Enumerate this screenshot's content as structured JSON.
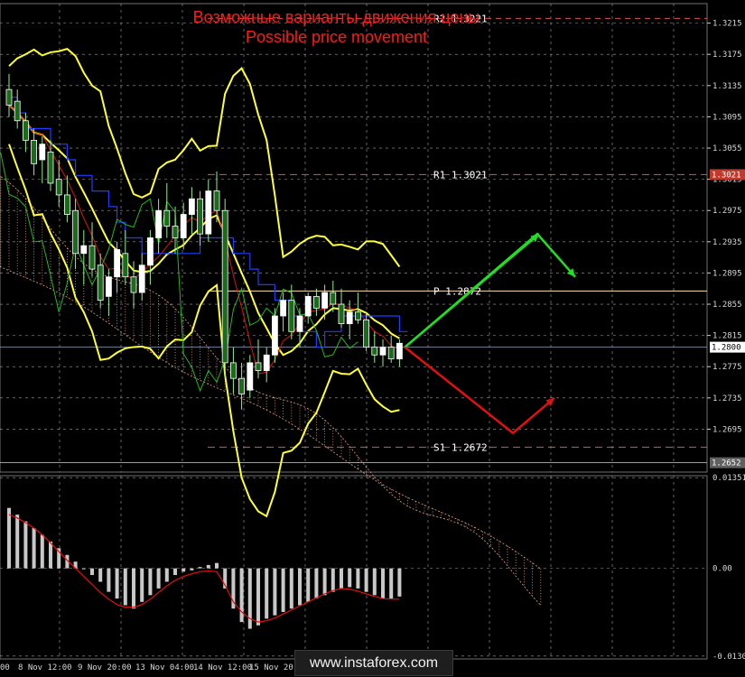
{
  "title_ru": "Возможные варианты движения цены",
  "title_en": "Possible price movement",
  "watermark": "www.instaforex.com",
  "colors": {
    "background": "#000000",
    "grid": "#a0a0a0",
    "bollinger": "#ffff33",
    "ma_blue": "#1e3cff",
    "ma_red": "#e01010",
    "chikou_green": "#22b822",
    "kumo": "#e8a07a",
    "up_arrow": "#22dd22",
    "down_arrow": "#e01010",
    "pivot_line": "#ffe0b0",
    "resistance_support": "#e05050",
    "histogram": "#c8c8c8",
    "signal": "#e01010"
  },
  "levels": {
    "r2_label": "R2 1.3221",
    "r1_label": "R1 1.3021",
    "p_label": "P 1.2872",
    "s1_label": "S1 1.2672",
    "current_price": "1.2800",
    "r1_box": "1.3021",
    "low_box": "1.2652"
  },
  "chart_data": {
    "type": "candlestick",
    "instrument": "",
    "price_axis": {
      "ticks": [
        "1.3215",
        "1.3175",
        "1.3135",
        "1.3095",
        "1.3055",
        "1.3015",
        "1.2975",
        "1.2935",
        "1.2895",
        "1.2855",
        "1.2815",
        "1.2775",
        "1.2735",
        "1.2695"
      ],
      "range": [
        1.264,
        1.324
      ]
    },
    "oscillator_axis": {
      "ticks": [
        "0.01351",
        "0.00",
        "-0.01307"
      ],
      "range": [
        -0.0135,
        0.0138
      ]
    },
    "time_axis": [
      "00",
      "8 Nov 12:00",
      "9 Nov 20:00",
      "13 Nov 04:00",
      "14 Nov 12:00",
      "15 Nov 20:00"
    ],
    "pivot_levels": {
      "R2": 1.3221,
      "R1": 1.3021,
      "P": 1.2872,
      "S1": 1.2672
    },
    "current_price": 1.28,
    "candles": [
      [
        1.313,
        1.315,
        1.3095,
        1.311
      ],
      [
        1.3115,
        1.313,
        1.308,
        1.309
      ],
      [
        1.309,
        1.31,
        1.305,
        1.3065
      ],
      [
        1.3065,
        1.308,
        1.302,
        1.3035
      ],
      [
        1.304,
        1.307,
        1.301,
        1.306
      ],
      [
        1.305,
        1.3065,
        1.3,
        1.301
      ],
      [
        1.3015,
        1.304,
        1.298,
        1.2995
      ],
      [
        1.2995,
        1.302,
        1.296,
        1.297
      ],
      [
        1.2975,
        1.299,
        1.29,
        1.292
      ],
      [
        1.292,
        1.295,
        1.288,
        1.293
      ],
      [
        1.293,
        1.296,
        1.289,
        1.29
      ],
      [
        1.2905,
        1.292,
        1.285,
        1.286
      ],
      [
        1.2865,
        1.29,
        1.284,
        1.289
      ],
      [
        1.289,
        1.2935,
        1.287,
        1.2925
      ],
      [
        1.292,
        1.295,
        1.288,
        1.289
      ],
      [
        1.289,
        1.291,
        1.285,
        1.287
      ],
      [
        1.287,
        1.292,
        1.286,
        1.2905
      ],
      [
        1.2905,
        1.295,
        1.288,
        1.294
      ],
      [
        1.294,
        1.299,
        1.292,
        1.2975
      ],
      [
        1.2975,
        1.301,
        1.294,
        1.2955
      ],
      [
        1.2955,
        1.298,
        1.292,
        1.294
      ],
      [
        1.294,
        1.2985,
        1.2925,
        1.297
      ],
      [
        1.297,
        1.3005,
        1.2945,
        1.299
      ],
      [
        1.299,
        1.3,
        1.293,
        1.2945
      ],
      [
        1.2945,
        1.3015,
        1.2935,
        1.3
      ],
      [
        1.3,
        1.3025,
        1.296,
        1.2975
      ],
      [
        1.2975,
        1.299,
        1.276,
        1.278
      ],
      [
        1.278,
        1.28,
        1.274,
        1.276
      ],
      [
        1.276,
        1.278,
        1.272,
        1.274
      ],
      [
        1.2745,
        1.279,
        1.2735,
        1.278
      ],
      [
        1.278,
        1.281,
        1.276,
        1.277
      ],
      [
        1.277,
        1.28,
        1.2755,
        1.279
      ],
      [
        1.279,
        1.285,
        1.278,
        1.284
      ],
      [
        1.284,
        1.287,
        1.282,
        1.286
      ],
      [
        1.286,
        1.288,
        1.281,
        1.282
      ],
      [
        1.282,
        1.285,
        1.28,
        1.284
      ],
      [
        1.284,
        1.287,
        1.283,
        1.2865
      ],
      [
        1.2865,
        1.2875,
        1.284,
        1.285
      ],
      [
        1.285,
        1.288,
        1.2835,
        1.287
      ],
      [
        1.287,
        1.2885,
        1.2845,
        1.2855
      ],
      [
        1.2855,
        1.2875,
        1.2825,
        1.283
      ],
      [
        1.283,
        1.286,
        1.281,
        1.2845
      ],
      [
        1.2845,
        1.287,
        1.283,
        1.2835
      ],
      [
        1.2835,
        1.2845,
        1.2795,
        1.28
      ],
      [
        1.28,
        1.282,
        1.278,
        1.279
      ],
      [
        1.279,
        1.281,
        1.2775,
        1.28
      ],
      [
        1.28,
        1.2815,
        1.278,
        1.2785
      ],
      [
        1.2785,
        1.281,
        1.2775,
        1.2805
      ]
    ],
    "oscillator": {
      "histogram": [
        0.009,
        0.008,
        0.007,
        0.006,
        0.005,
        0.004,
        0.003,
        0.002,
        0.001,
        0.0,
        -0.001,
        -0.002,
        -0.0035,
        -0.0045,
        -0.0055,
        -0.006,
        -0.005,
        -0.004,
        -0.003,
        -0.002,
        -0.001,
        -0.0005,
        -0.0003,
        0.0002,
        0.0005,
        0.0008,
        -0.003,
        -0.006,
        -0.008,
        -0.009,
        -0.0085,
        -0.0075,
        -0.007,
        -0.0065,
        -0.006,
        -0.0055,
        -0.005,
        -0.0045,
        -0.004,
        -0.0035,
        -0.003,
        -0.0028,
        -0.003,
        -0.0035,
        -0.004,
        -0.0045,
        -0.0045,
        -0.0042
      ],
      "signal": [
        0.008,
        0.0075,
        0.0068,
        0.006,
        0.005,
        0.0038,
        0.0025,
        0.0012,
        0.0,
        -0.0012,
        -0.0024,
        -0.0036,
        -0.0046,
        -0.0054,
        -0.0058,
        -0.0058,
        -0.0054,
        -0.0046,
        -0.0036,
        -0.0026,
        -0.0018,
        -0.0012,
        -0.0008,
        -0.0005,
        -0.0004,
        -0.0005,
        -0.0025,
        -0.005,
        -0.0065,
        -0.0075,
        -0.008,
        -0.0078,
        -0.0074,
        -0.0068,
        -0.0062,
        -0.0056,
        -0.005,
        -0.0044,
        -0.0038,
        -0.0033,
        -0.003,
        -0.0031,
        -0.0034,
        -0.0038,
        -0.0042,
        -0.0045,
        -0.0046,
        -0.0046
      ]
    },
    "forecast": {
      "up_path": [
        1.28,
        1.2945,
        1.289
      ],
      "down_path": [
        1.28,
        1.269,
        1.2735
      ]
    }
  }
}
